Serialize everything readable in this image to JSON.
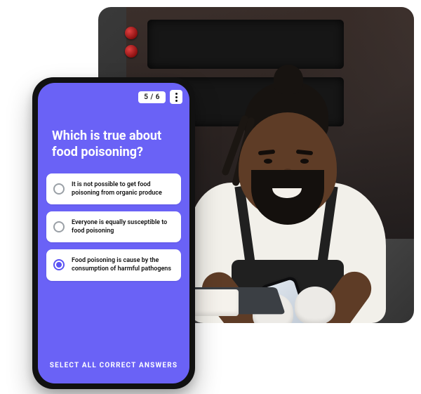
{
  "progress": {
    "counter": "5 / 6"
  },
  "question": {
    "text": "Which is true about food poisoning?"
  },
  "options": [
    {
      "text": "It is not possible to get food poisoning from organic produce",
      "selected": false
    },
    {
      "text": "Everyone is equally susceptible to food poisoning",
      "selected": false
    },
    {
      "text": "Food poisoning is cause by the consumption of harmful pathogens",
      "selected": true
    }
  ],
  "hint": "SELECT ALL CORRECT ANSWERS",
  "background": {
    "description": "Man in commercial kitchen wearing apron and gloves, smiling while using a smartphone in front of pizza ovens"
  }
}
